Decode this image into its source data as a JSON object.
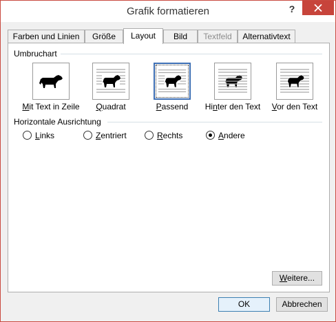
{
  "window": {
    "title": "Grafik formatieren",
    "help_symbol": "?"
  },
  "tabs": [
    {
      "label": "Farben und Linien",
      "state": "normal"
    },
    {
      "label": "Größe",
      "state": "normal"
    },
    {
      "label": "Layout",
      "state": "active"
    },
    {
      "label": "Bild",
      "state": "normal"
    },
    {
      "label": "Textfeld",
      "state": "disabled"
    },
    {
      "label": "Alternativtext",
      "state": "normal"
    }
  ],
  "wrapping": {
    "group_label": "Umbruchart",
    "selected": "Passend",
    "options": [
      {
        "label_pre": "",
        "label_accel": "M",
        "label_post": "it Text in Zeile"
      },
      {
        "label_pre": "",
        "label_accel": "Q",
        "label_post": "uadrat"
      },
      {
        "label_pre": "",
        "label_accel": "P",
        "label_post": "assend"
      },
      {
        "label_pre": "Hi",
        "label_accel": "n",
        "label_post": "ter den Text"
      },
      {
        "label_pre": "",
        "label_accel": "V",
        "label_post": "or den Text"
      }
    ]
  },
  "alignment": {
    "group_label": "Horizontale Ausrichtung",
    "selected": "Andere",
    "options": [
      {
        "label_pre": "",
        "label_accel": "L",
        "label_post": "inks"
      },
      {
        "label_pre": "",
        "label_accel": "Z",
        "label_post": "entriert"
      },
      {
        "label_pre": "",
        "label_accel": "R",
        "label_post": "echts"
      },
      {
        "label_pre": "",
        "label_accel": "A",
        "label_post": "ndere"
      }
    ]
  },
  "buttons": {
    "more": {
      "label_pre": "",
      "label_accel": "W",
      "label_post": "eitere..."
    },
    "ok": "OK",
    "cancel": "Abbrechen"
  },
  "colors": {
    "close_button": "#c7443b",
    "selection_border": "#3c6eb4",
    "default_button_border": "#3c7fb1"
  },
  "icons": {
    "close": "close-icon",
    "wrap_image": "dog-icon"
  }
}
